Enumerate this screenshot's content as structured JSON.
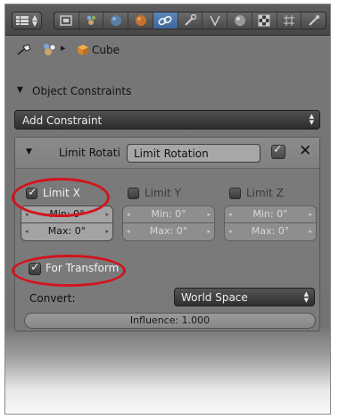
{
  "toolbar": {
    "editor_type_icon": "properties-editor-icon",
    "tabs": [
      {
        "icon": "render-icon",
        "active": false
      },
      {
        "icon": "scene-icon",
        "active": false
      },
      {
        "icon": "world-icon",
        "active": false
      },
      {
        "icon": "object-icon",
        "active": false
      },
      {
        "icon": "constraint-link-icon",
        "active": true
      },
      {
        "icon": "wrench-modifier-icon",
        "active": false
      },
      {
        "icon": "vertex-data-icon",
        "active": false
      },
      {
        "icon": "material-icon",
        "active": false
      },
      {
        "icon": "texture-icon",
        "active": false
      },
      {
        "icon": "particles-icon",
        "active": false
      },
      {
        "icon": "physics-icon",
        "active": false
      }
    ]
  },
  "breadcrumb": {
    "object_label": "Cube"
  },
  "panel": {
    "title": "Object Constraints"
  },
  "add_constraint": {
    "label": "Add Constraint"
  },
  "constraint": {
    "type_label": "Limit Rotati",
    "name_value": "Limit Rotation",
    "enabled": true,
    "axes": [
      {
        "label": "Limit X",
        "checked": true,
        "min": "Min: 0°",
        "max": "Max: 0°"
      },
      {
        "label": "Limit Y",
        "checked": false,
        "min": "Min: 0°",
        "max": "Max: 0°"
      },
      {
        "label": "Limit Z",
        "checked": false,
        "min": "Min: 0°",
        "max": "Max: 0°"
      }
    ],
    "for_transform": {
      "label": "For Transform",
      "checked": true
    },
    "convert": {
      "label": "Convert:",
      "value": "World Space"
    },
    "influence": "Influence: 1.000"
  },
  "colors": {
    "highlight_ring": "#d2141e",
    "active_tab": "#4a76ab"
  }
}
